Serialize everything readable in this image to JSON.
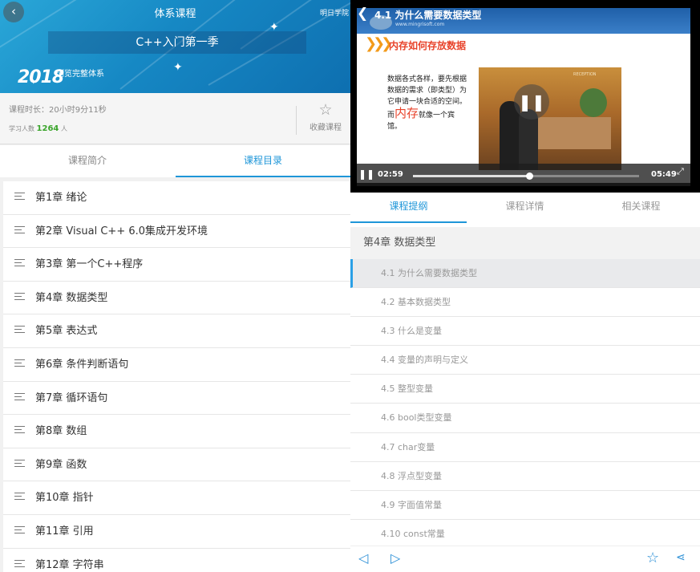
{
  "colors": {
    "accent": "#1e96d8",
    "student_count": "#3aa52b",
    "banner": "#1688c4",
    "slide_heading": "#e8432b"
  },
  "left": {
    "header": {
      "title": "体系课程",
      "school": "明日学院",
      "course_name": "C++入门第一季",
      "browse_full": "浏览完整体系",
      "year_logo": "2018",
      "back_icon": "back-arrow-icon"
    },
    "info": {
      "duration": "课程时长：20小时9分11秒",
      "students_label": "学习人数",
      "students_count": "1264",
      "students_unit": "人",
      "favorite_label": "收藏课程",
      "favorite_icon": "star-outline-icon"
    },
    "tabs": [
      {
        "label": "课程简介",
        "active": false
      },
      {
        "label": "课程目录",
        "active": true
      }
    ],
    "chapters": [
      "第1章 绪论",
      "第2章 Visual C++ 6.0集成开发环境",
      "第3章 第一个C++程序",
      "第4章 数据类型",
      "第5章 表达式",
      "第6章 条件判断语句",
      "第7章 循环语句",
      "第8章 数组",
      "第9章 函数",
      "第10章 指针",
      "第11章 引用",
      "第12章 字符串"
    ]
  },
  "right": {
    "video": {
      "title": "4.1 为什么需要数据类型",
      "back_icon": "back-arrow-icon",
      "slide_site": "www.mingrisoft.com",
      "slide_heading": "内存如何存放数据",
      "slide_text_1": "数据各式各样，要先根据数据的需求（即类型）为它申请一块合适的空间。而",
      "slide_text_highlight": "内存",
      "slide_text_2": "就像一个宾馆。",
      "photo_sign": "RECEPTION",
      "current_time": "02:59",
      "total_time": "05:49",
      "progress": 0.513
    },
    "tabs": [
      {
        "label": "课程提纲",
        "active": true
      },
      {
        "label": "课程详情",
        "active": false
      },
      {
        "label": "相关课程",
        "active": false
      }
    ],
    "chapter_header": "第4章 数据类型",
    "sections": [
      "4.1 为什么需要数据类型",
      "4.2 基本数据类型",
      "4.3 什么是变量",
      "4.4 变量的声明与定义",
      "4.5 整型变量",
      "4.6 bool类型变量",
      "4.7 char变量",
      "4.8 浮点型变量",
      "4.9 字面值常量",
      "4.10 const常量"
    ],
    "current_section_index": 0,
    "bottom_bar": {
      "prev_icon": "prev-triangle-icon",
      "next_icon": "next-triangle-icon",
      "favorite_icon": "star-outline-icon",
      "share_icon": "share-icon"
    }
  }
}
